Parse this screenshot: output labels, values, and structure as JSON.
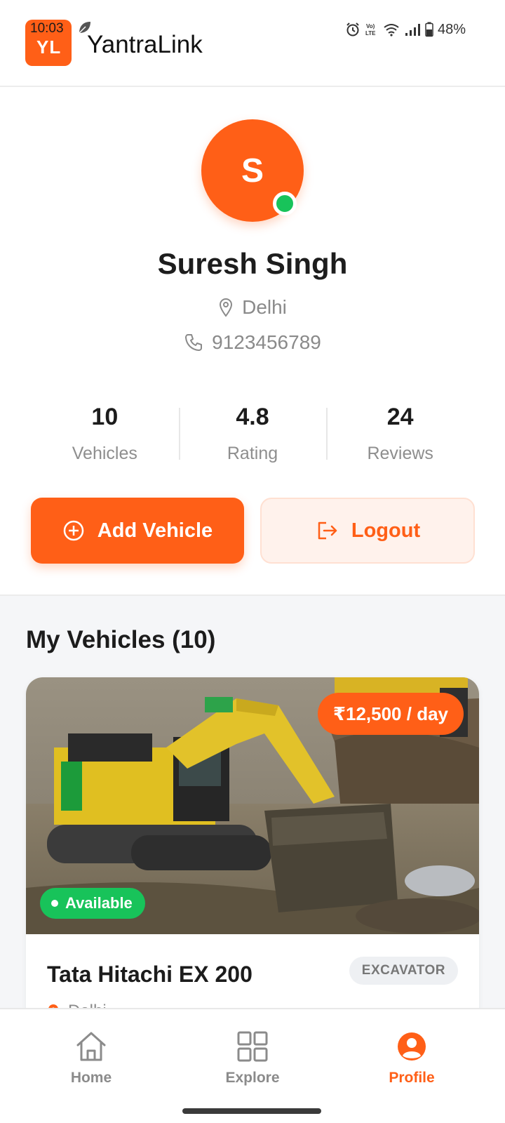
{
  "status_bar": {
    "time": "10:03",
    "battery": "48%"
  },
  "header": {
    "logo_text": "YL",
    "app_name": "YantraLink"
  },
  "profile": {
    "avatar_initial": "S",
    "name": "Suresh Singh",
    "location": "Delhi",
    "phone": "9123456789"
  },
  "stats": [
    {
      "value": "10",
      "label": "Vehicles"
    },
    {
      "value": "4.8",
      "label": "Rating"
    },
    {
      "value": "24",
      "label": "Reviews"
    }
  ],
  "actions": {
    "add_vehicle": "Add Vehicle",
    "logout": "Logout"
  },
  "vehicles_section": {
    "title": "My Vehicles (10)",
    "cards": [
      {
        "price": "₹12,500 / day",
        "status": "Available",
        "name": "Tata Hitachi EX 200",
        "type": "EXCAVATOR",
        "location": "Delhi"
      }
    ]
  },
  "bottom_nav": [
    {
      "label": "Home",
      "icon": "home-icon",
      "active": false
    },
    {
      "label": "Explore",
      "icon": "grid-icon",
      "active": false
    },
    {
      "label": "Profile",
      "icon": "profile-icon",
      "active": true
    }
  ],
  "colors": {
    "accent": "#ff5f17",
    "online": "#18c35a",
    "available": "#18c35a"
  }
}
